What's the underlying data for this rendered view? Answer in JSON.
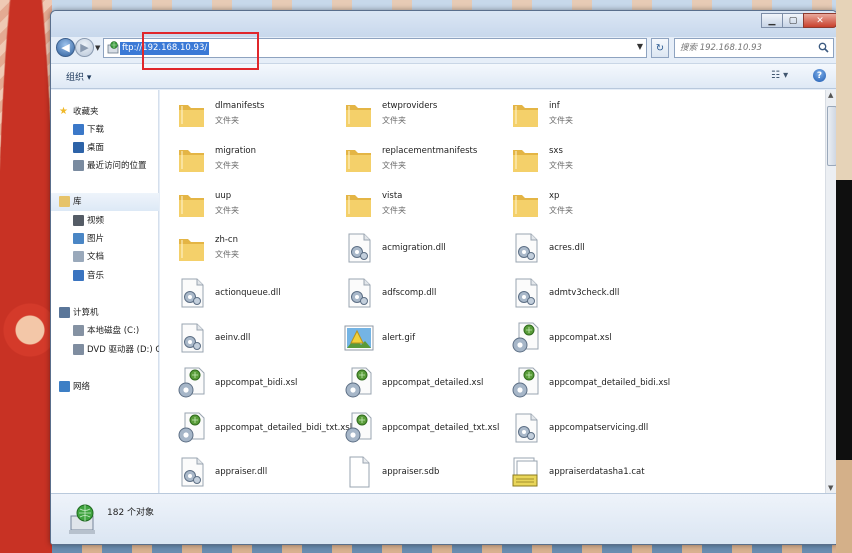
{
  "address": {
    "value": "ftp://192.168.10.93/"
  },
  "search": {
    "placeholder": "搜索 192.168.10.93"
  },
  "toolbar": {
    "organize_label": "组织 ▾"
  },
  "nav": {
    "items": [
      {
        "id": "favorites",
        "label": "收藏夹",
        "icon": "star-icon"
      },
      {
        "id": "downloads",
        "label": "下载",
        "icon": "download-icon"
      },
      {
        "id": "desktop",
        "label": "桌面",
        "icon": "desktop-icon"
      },
      {
        "id": "recent",
        "label": "最近访问的位置",
        "icon": "recent-places-icon"
      },
      {
        "id": "libraries",
        "label": "库",
        "icon": "library-icon"
      },
      {
        "id": "videos",
        "label": "视频",
        "icon": "video-icon"
      },
      {
        "id": "pictures",
        "label": "图片",
        "icon": "pictures-icon"
      },
      {
        "id": "documents",
        "label": "文档",
        "icon": "documents-icon"
      },
      {
        "id": "music",
        "label": "音乐",
        "icon": "music-icon"
      },
      {
        "id": "computer",
        "label": "计算机",
        "icon": "computer-icon"
      },
      {
        "id": "localdisk",
        "label": "本地磁盘 (C:)",
        "icon": "disk-icon"
      },
      {
        "id": "dvd",
        "label": "DVD 驱动器 (D:) GF",
        "icon": "dvd-icon"
      },
      {
        "id": "network",
        "label": "网络",
        "icon": "network-icon"
      }
    ]
  },
  "files": [
    {
      "name": "dlmanifests",
      "type": "文件夹",
      "icon": "folder"
    },
    {
      "name": "etwproviders",
      "type": "文件夹",
      "icon": "folder"
    },
    {
      "name": "inf",
      "type": "文件夹",
      "icon": "folder"
    },
    {
      "name": "migration",
      "type": "文件夹",
      "icon": "folder"
    },
    {
      "name": "replacementmanifests",
      "type": "文件夹",
      "icon": "folder"
    },
    {
      "name": "sxs",
      "type": "文件夹",
      "icon": "folder"
    },
    {
      "name": "uup",
      "type": "文件夹",
      "icon": "folder"
    },
    {
      "name": "vista",
      "type": "文件夹",
      "icon": "folder"
    },
    {
      "name": "xp",
      "type": "文件夹",
      "icon": "folder"
    },
    {
      "name": "zh-cn",
      "type": "文件夹",
      "icon": "folder"
    },
    {
      "name": "acmigration.dll",
      "type": "",
      "icon": "dll"
    },
    {
      "name": "acres.dll",
      "type": "",
      "icon": "dll"
    },
    {
      "name": "actionqueue.dll",
      "type": "",
      "icon": "dll"
    },
    {
      "name": "adfscomp.dll",
      "type": "",
      "icon": "dll"
    },
    {
      "name": "admtv3check.dll",
      "type": "",
      "icon": "dll"
    },
    {
      "name": "aeinv.dll",
      "type": "",
      "icon": "dll"
    },
    {
      "name": "alert.gif",
      "type": "",
      "icon": "image"
    },
    {
      "name": "appcompat.xsl",
      "type": "",
      "icon": "xsl"
    },
    {
      "name": "appcompat_bidi.xsl",
      "type": "",
      "icon": "xsl"
    },
    {
      "name": "appcompat_detailed.xsl",
      "type": "",
      "icon": "xsl"
    },
    {
      "name": "appcompat_detailed_bidi.xsl",
      "type": "",
      "icon": "xsl"
    },
    {
      "name": "appcompat_detailed_bidi_txt.xsl",
      "type": "",
      "icon": "xsl"
    },
    {
      "name": "appcompat_detailed_txt.xsl",
      "type": "",
      "icon": "xsl"
    },
    {
      "name": "appcompatservicing.dll",
      "type": "",
      "icon": "dll"
    },
    {
      "name": "appraiser.dll",
      "type": "",
      "icon": "dll"
    },
    {
      "name": "appraiser.sdb",
      "type": "",
      "icon": "blank"
    },
    {
      "name": "appraiserdatasha1.cat",
      "type": "",
      "icon": "cat"
    }
  ],
  "status": {
    "text": "182 个对象"
  },
  "colors": {
    "accent": "#3a79d6",
    "highlight_box": "#e0262b",
    "folder": "#f2c75c"
  }
}
